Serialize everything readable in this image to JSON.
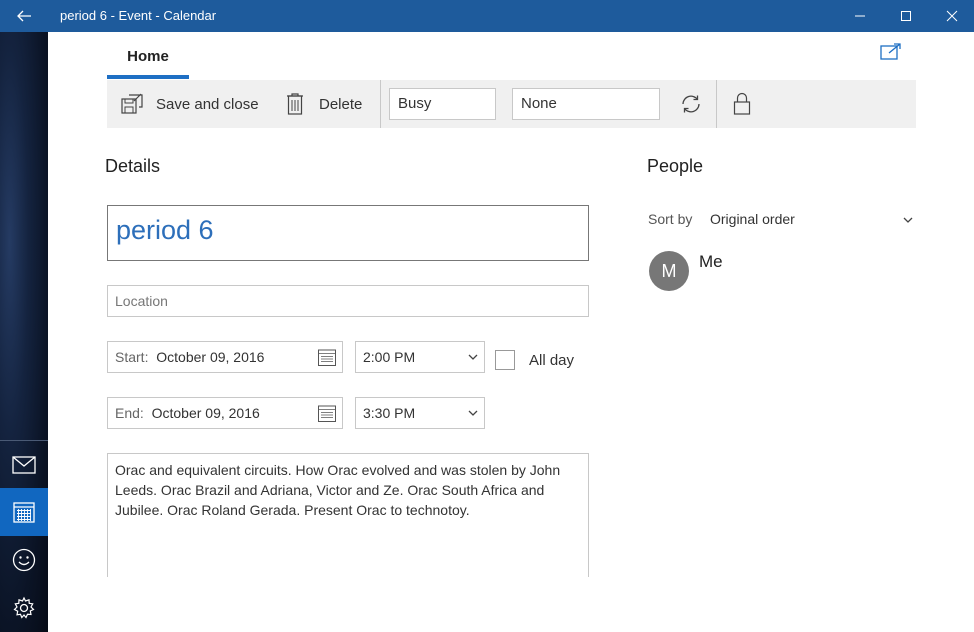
{
  "window": {
    "title": "period 6 - Event - Calendar",
    "accent": "#1e5b9c"
  },
  "icons": {
    "back": "back-arrow-icon",
    "minimize": "minimize-icon",
    "maximize": "maximize-icon",
    "close": "close-icon",
    "mail": "mail-icon",
    "calendar": "calendar-icon",
    "people": "smiley-icon",
    "settings": "gear-icon",
    "popout": "popout-icon",
    "save": "save-icon",
    "delete": "trash-icon",
    "sync": "sync-icon",
    "lock": "lock-icon"
  },
  "tabs": {
    "home": "Home"
  },
  "toolbar": {
    "save_label": "Save and close",
    "delete_label": "Delete",
    "show_as": "Busy",
    "reminder": "None"
  },
  "details": {
    "heading": "Details",
    "title": "period 6",
    "location_placeholder": "Location",
    "start_label": "Start:",
    "start_date": "October 09, 2016",
    "start_time": "2:00 PM",
    "end_label": "End:",
    "end_date": "October 09, 2016",
    "end_time": "3:30 PM",
    "all_day_label": "All day",
    "notes": "Orac and equivalent circuits.  How Orac evolved and was stolen by John Leeds. Orac Brazil and Adriana, Victor and Ze.  Orac South Africa and Jubilee. Orac Roland Gerada.  Present Orac to technotoy."
  },
  "people": {
    "heading": "People",
    "sort_label": "Sort by",
    "sort_value": "Original order",
    "attendees": [
      {
        "initial": "M",
        "name": "Me"
      }
    ]
  }
}
